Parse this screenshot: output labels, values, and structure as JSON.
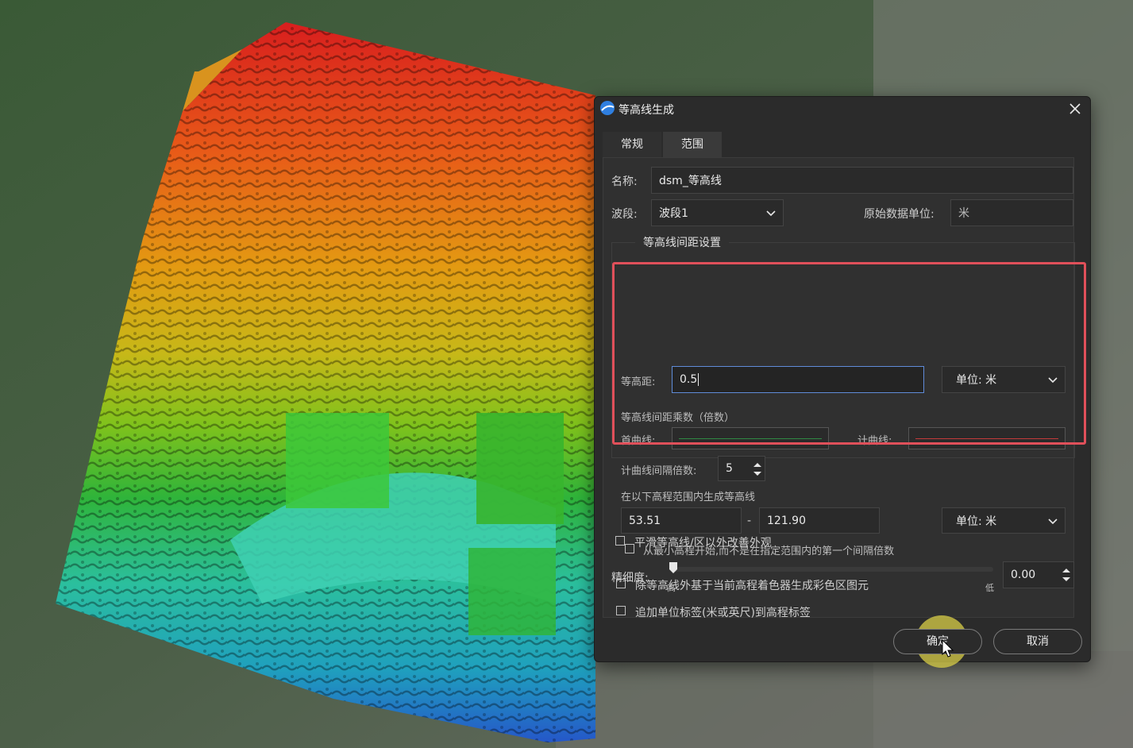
{
  "dialog": {
    "title": "等高线生成",
    "tabs": [
      {
        "label": "常规",
        "active": true
      },
      {
        "label": "范围",
        "active": false
      }
    ],
    "name_label": "名称:",
    "name_value": "dsm_等高线",
    "band_label": "波段:",
    "band_value": "波段1",
    "orig_unit_label": "原始数据单位:",
    "orig_unit_value": "米",
    "group_title": "等高线间距设置",
    "interval_label": "等高距:",
    "interval_value": "0.5",
    "interval_unit": "单位: 米",
    "multiplier_label": "等高线间距乘数（倍数）",
    "first_curve_label": "首曲线:",
    "first_curve_color": "#2f8a44",
    "index_curve_label": "计曲线:",
    "index_curve_color": "#c43a3a",
    "index_interval_label": "计曲线间隔倍数:",
    "index_interval_value": "5",
    "range_label": "在以下高程范围内生成等高线",
    "range_min": "53.51",
    "range_sep": "-",
    "range_max": "121.90",
    "range_unit": "单位: 米",
    "cb_start_min": "从最小高程开始,而不是在指定范围内的第一个间隔倍数",
    "cb_color_zones": "除等高线外基于当前高程着色器生成彩色区图元",
    "cb_unit_label": "追加单位标签(米或英尺)到高程标签",
    "cb_smooth": "平滑等高线/区以外改善外观",
    "precision_label": "精细度:",
    "slider_high": "高",
    "slider_low": "低",
    "precision_value": "0.00",
    "ok_label": "确定",
    "cancel_label": "取消"
  },
  "colors": {
    "accent_focus": "#5f8cd9",
    "highlight_box": "#e0505a",
    "dialog_bg": "#2b2b2b"
  }
}
